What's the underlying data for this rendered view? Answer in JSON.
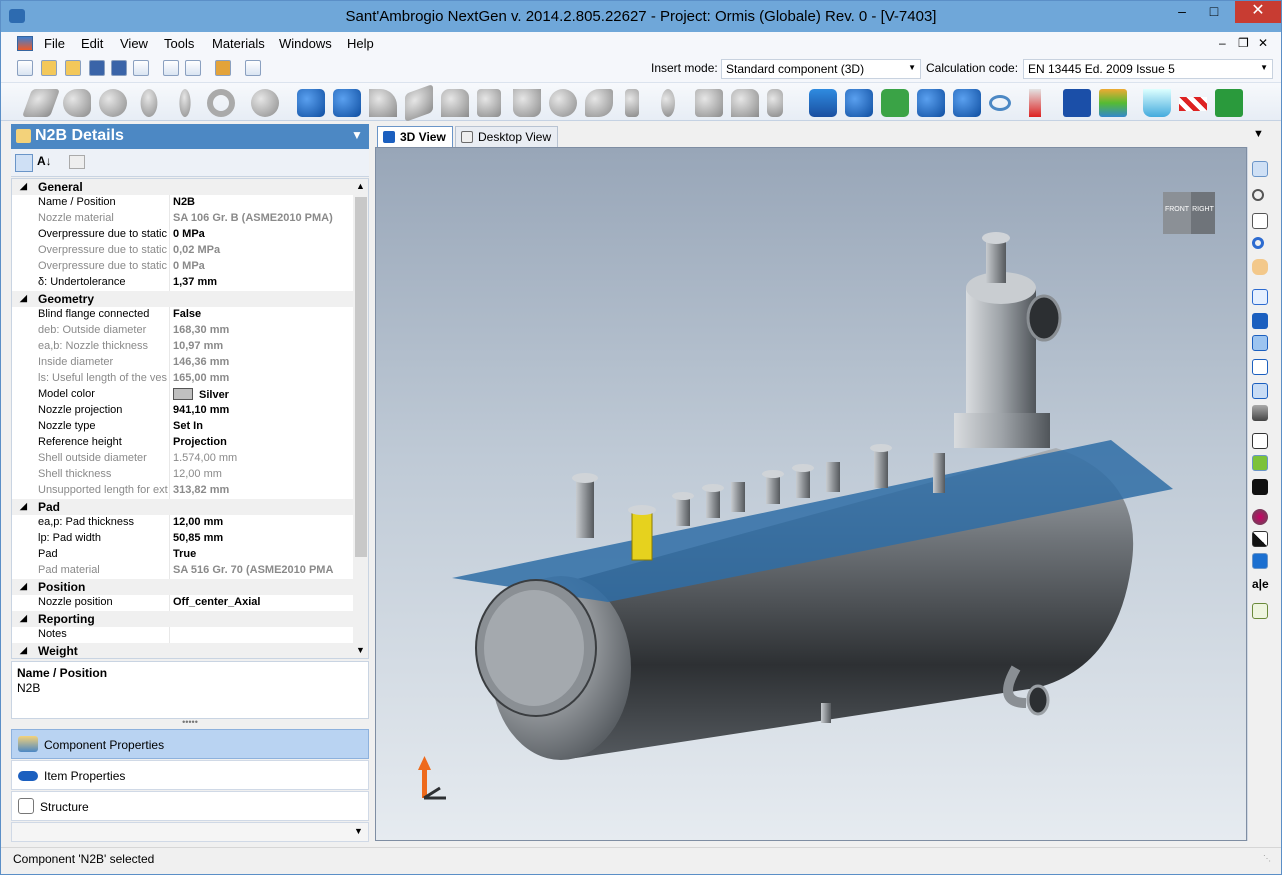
{
  "window": {
    "title": "Sant'Ambrogio NextGen  v. 2014.2.805.22627 - Project: Ormis (Globale) Rev. 0 - [V-7403]"
  },
  "menu": [
    "File",
    "Edit",
    "View",
    "Tools",
    "Materials",
    "Windows",
    "Help"
  ],
  "toolbar": {
    "insert_mode_label": "Insert mode:",
    "insert_mode_value": "Standard component (3D)",
    "calc_code_label": "Calculation code:",
    "calc_code_value": "EN 13445 Ed. 2009 Issue 5"
  },
  "panel": {
    "title": "N2B Details",
    "categories": {
      "general": "General",
      "geometry": "Geometry",
      "pad": "Pad",
      "position": "Position",
      "reporting": "Reporting",
      "weight": "Weight"
    },
    "general": [
      {
        "name": "Name / Position",
        "value": "N2B",
        "dim": false
      },
      {
        "name": "Nozzle material",
        "value": "SA 106 Gr. B (ASME2010 PMA)",
        "dim": true
      },
      {
        "name": "Overpressure due to static",
        "value": "0 MPa",
        "dim": false
      },
      {
        "name": "Overpressure due to static",
        "value": "0,02 MPa",
        "dim": true
      },
      {
        "name": "Overpressure due to static",
        "value": "0 MPa",
        "dim": true
      },
      {
        "name": "δ:  Undertolerance",
        "value": "1,37 mm",
        "dim": false
      }
    ],
    "geometry": [
      {
        "name": "Blind flange connected",
        "value": "False",
        "dim": false
      },
      {
        "name": "deb:  Outside diameter",
        "value": "168,30 mm",
        "dim": true
      },
      {
        "name": "ea,b:  Nozzle thickness",
        "value": "10,97 mm",
        "dim": true
      },
      {
        "name": "Inside diameter",
        "value": "146,36 mm",
        "dim": true
      },
      {
        "name": "ls:  Useful length of the ves",
        "value": "165,00 mm",
        "dim": true
      },
      {
        "name": "Model color",
        "value": "Silver",
        "dim": false
      },
      {
        "name": "Nozzle projection",
        "value": "941,10 mm",
        "dim": false
      },
      {
        "name": "Nozzle type",
        "value": "Set In",
        "dim": false
      },
      {
        "name": "Reference height",
        "value": "Projection",
        "dim": false
      },
      {
        "name": "Shell outside diameter",
        "value": "1.574,00 mm",
        "dim": true
      },
      {
        "name": "Shell thickness",
        "value": "12,00 mm",
        "dim": true
      },
      {
        "name": "Unsupported length for ext",
        "value": "313,82 mm",
        "dim": true
      }
    ],
    "pad": [
      {
        "name": "ea,p:  Pad thickness",
        "value": "12,00 mm",
        "dim": false
      },
      {
        "name": "lp:  Pad width",
        "value": "50,85 mm",
        "dim": false
      },
      {
        "name": "Pad",
        "value": "True",
        "dim": false
      },
      {
        "name": "Pad material",
        "value": "SA 516 Gr. 70 (ASME2010 PMA",
        "dim": true
      }
    ],
    "position": [
      {
        "name": "Nozzle position",
        "value": "Off_center_Axial",
        "dim": false
      }
    ],
    "reporting": [
      {
        "name": "Notes",
        "value": "",
        "dim": false
      }
    ],
    "description": {
      "heading": "Name / Position",
      "text": "N2B"
    }
  },
  "nav": {
    "component_properties": "Component Properties",
    "item_properties": "Item Properties",
    "structure": "Structure"
  },
  "tabs": {
    "view3d": "3D View",
    "desktop": "Desktop View"
  },
  "viewcube": {
    "front": "FRONT",
    "right": "RIGHT"
  },
  "status": "Component 'N2B' selected",
  "colors": {
    "accent": "#4c88c4",
    "selected_nozzle": "#e6d21e",
    "vessel": "#6c6c6c"
  }
}
